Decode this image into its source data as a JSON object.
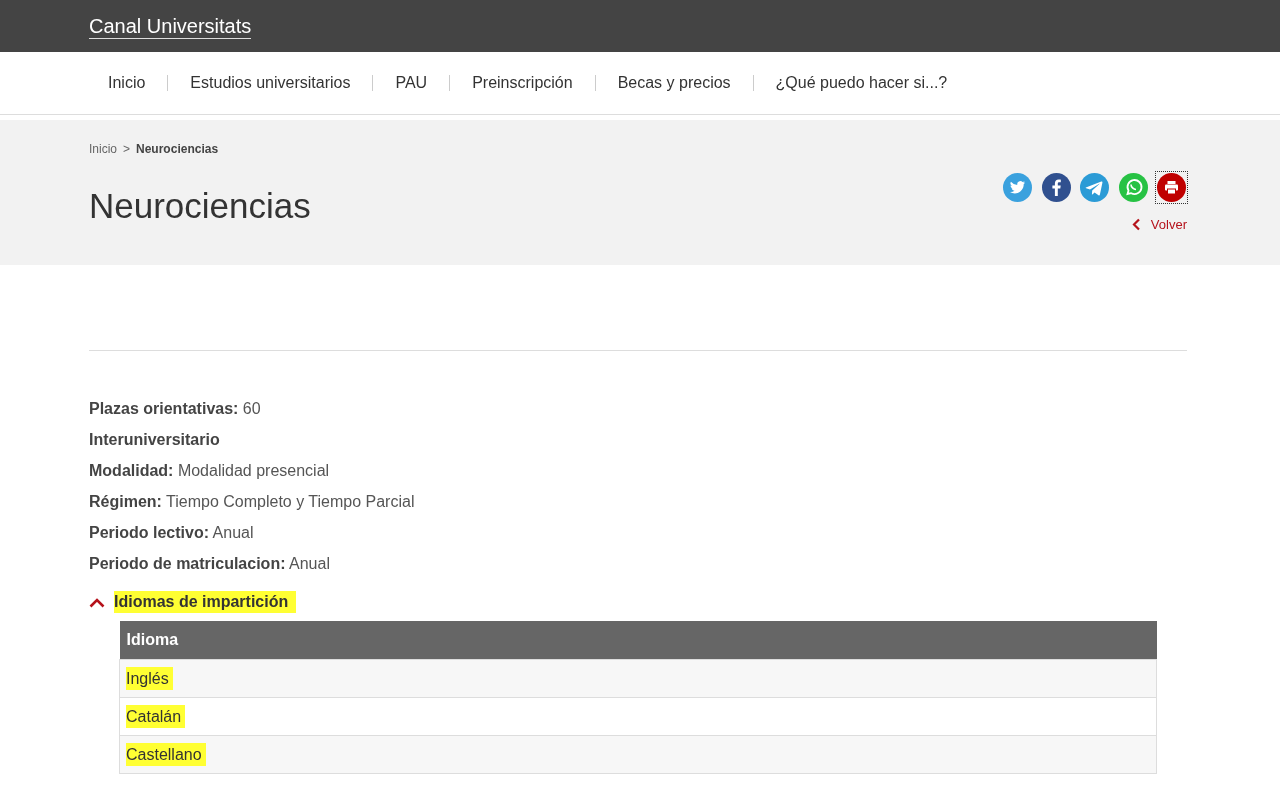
{
  "site_title": "Canal Universitats",
  "nav": [
    {
      "label": "Inicio"
    },
    {
      "label": "Estudios universitarios"
    },
    {
      "label": "PAU"
    },
    {
      "label": "Preinscripción"
    },
    {
      "label": "Becas y precios"
    },
    {
      "label": "¿Qué puedo hacer si...?"
    }
  ],
  "breadcrumb": {
    "items": [
      {
        "label": "Inicio",
        "current": false
      },
      {
        "label": "Neurociencias",
        "current": true
      }
    ],
    "separator": ">"
  },
  "page_title": "Neurociencias",
  "share_buttons": [
    {
      "kind": "twitter",
      "focused": false
    },
    {
      "kind": "facebook",
      "focused": false
    },
    {
      "kind": "telegram",
      "focused": false
    },
    {
      "kind": "whatsapp",
      "focused": false
    },
    {
      "kind": "print",
      "focused": true
    }
  ],
  "back_link": "Volver",
  "details": [
    {
      "label": "Plazas orientativas:",
      "value": "60"
    },
    {
      "label": "Interuniversitario"
    },
    {
      "label": "Modalidad:",
      "value": "Modalidad presencial"
    },
    {
      "label": "Régimen:",
      "value": "Tiempo Completo y Tiempo Parcial"
    },
    {
      "label": "Periodo lectivo:",
      "value": "Anual"
    },
    {
      "label": "Periodo de matriculacion:",
      "value": "Anual"
    }
  ],
  "accordion": {
    "title": "Idiomas de impartición",
    "expanded": true,
    "highlighted": true,
    "table": {
      "columns": [
        "Idioma"
      ],
      "rows": [
        {
          "cells": [
            "Inglés"
          ],
          "highlighted": true
        },
        {
          "cells": [
            "Catalán"
          ],
          "highlighted": true
        },
        {
          "cells": [
            "Castellano"
          ],
          "highlighted": true
        }
      ]
    }
  }
}
